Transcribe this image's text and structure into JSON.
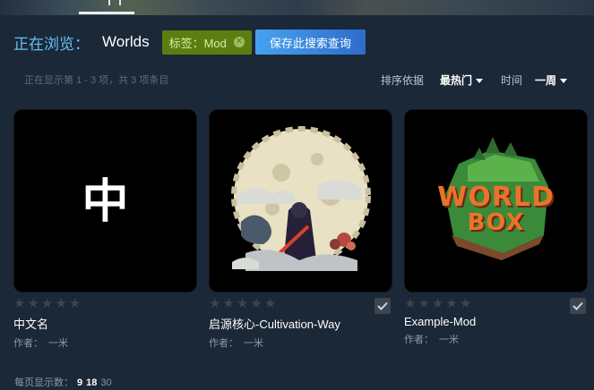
{
  "header": {
    "browse_prefix": "正在浏览：",
    "app_name": "Worlds",
    "tag_filter": "标签：Mod",
    "save_search_label": "保存此搜索查询"
  },
  "results": {
    "count_text": "正在显示第 1 - 3 项，共 3 项条目"
  },
  "sort": {
    "by_label": "排序依据",
    "by_value": "最热门",
    "time_label": "时间",
    "time_value": "一周"
  },
  "items": [
    {
      "title": "中文名",
      "author_label": "作者：",
      "author": "一米",
      "rating_stars": 0,
      "thumb_glyph": "中",
      "subscribed": false
    },
    {
      "title": "启源核心-Cultivation-Way",
      "author_label": "作者：",
      "author": "一米",
      "rating_stars": 0,
      "subscribed": true
    },
    {
      "title": "Example-Mod",
      "author_label": "作者：",
      "author": "一米",
      "rating_stars": 0,
      "thumb_text_top": "WORLD",
      "thumb_text_bottom": "BOX",
      "subscribed": true
    }
  ],
  "pagination": {
    "per_page_label": "每页显示数：",
    "options": [
      "9",
      "18",
      "30"
    ],
    "selected": "9"
  },
  "colors": {
    "background": "#1b2838",
    "accent_blue": "#66c0f4",
    "tag_green": "#5c7e10",
    "button_blue": "#3a7dd8"
  }
}
